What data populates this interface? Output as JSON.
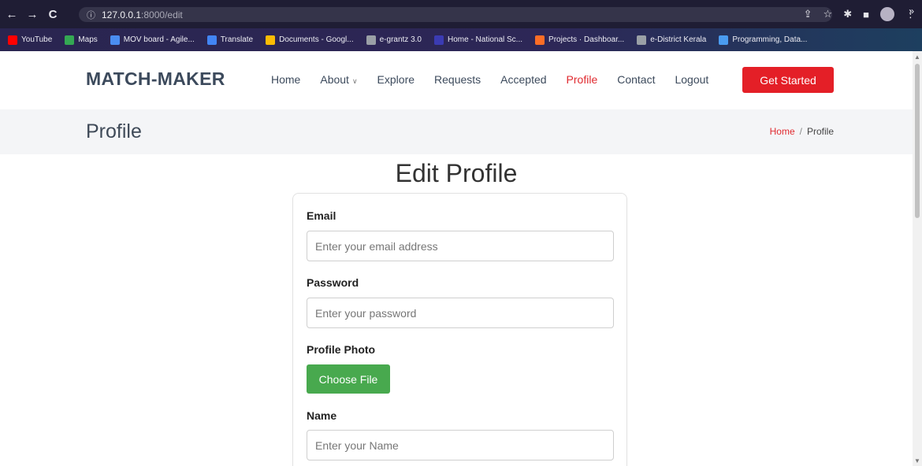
{
  "browser": {
    "url_host": "127.0.0.1",
    "url_path": ":8000/edit",
    "bookmarks": [
      {
        "label": "YouTube",
        "color": "#ff0000"
      },
      {
        "label": "Maps",
        "color": "#34a853"
      },
      {
        "label": "MOV board - Agile...",
        "color": "#4a8df0"
      },
      {
        "label": "Translate",
        "color": "#4285f4"
      },
      {
        "label": "Documents - Googl...",
        "color": "#fbbc04"
      },
      {
        "label": "e-grantz 3.0",
        "color": "#9aa0a6"
      },
      {
        "label": "Home - National Sc...",
        "color": "#3b3bb3"
      },
      {
        "label": "Projects · Dashboar...",
        "color": "#fc6d26"
      },
      {
        "label": "e-District Kerala",
        "color": "#9aa0a6"
      },
      {
        "label": "Programming, Data...",
        "color": "#4a9bf0"
      }
    ]
  },
  "header": {
    "logo": "MATCH-MAKER",
    "menu": [
      "Home",
      "About",
      "Explore",
      "Requests",
      "Accepted",
      "Profile",
      "Contact",
      "Logout"
    ],
    "active": "Profile",
    "cta": "Get Started"
  },
  "breadcrumbs": {
    "title": "Profile",
    "home": "Home",
    "separator": "/",
    "current": "Profile"
  },
  "form": {
    "title": "Edit Profile",
    "email_label": "Email",
    "email_placeholder": "Enter your email address",
    "password_label": "Password",
    "password_placeholder": "Enter your password",
    "photo_label": "Profile Photo",
    "choose_file": "Choose File",
    "name_label": "Name",
    "name_placeholder": "Enter your Name"
  },
  "colors": {
    "accent": "#e41f27",
    "file_button": "#48a94e"
  }
}
